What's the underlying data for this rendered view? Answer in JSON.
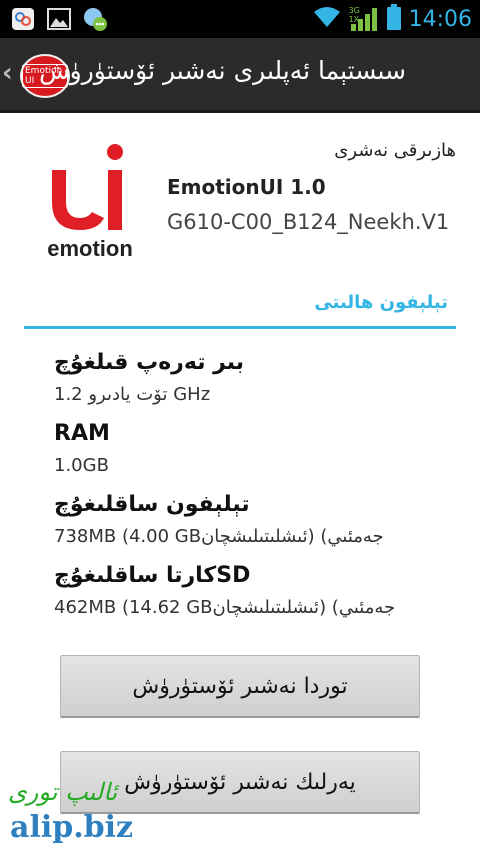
{
  "status_bar": {
    "time": "14:06",
    "network_label_3g": "3G",
    "network_label_1x": "1X",
    "icons": [
      "share-app-icon",
      "gallery-icon",
      "chat-app-icon",
      "wifi-icon",
      "signal-icon",
      "battery-icon"
    ]
  },
  "action_bar": {
    "logo_text": "Emotion UI",
    "title": "سىستېما ئەپلىرى نەشىر ئۆستۈرۈش"
  },
  "brand": {
    "logo_word": "emotion",
    "brand_color": "#e01e26"
  },
  "version": {
    "label": "ھازىرقى نەشرى",
    "product_name": "EmotionUI 1.0",
    "build_number": "G610-C00_B124_Neekh.V1"
  },
  "section": {
    "title": "تېلېفون ھالىتى",
    "accent_color": "#33b5e5"
  },
  "items": [
    {
      "title": "بىر تەرەپ قىلغۇچ",
      "value": "تۆت يادىرو 1.2 GHz"
    },
    {
      "title": "RAM",
      "value": "1.0GB"
    },
    {
      "title": "تېلېفون ساقلىغۇچ",
      "value": "738MB (4.00  GBئىشلىتىلىشچان) (جەمئىي"
    },
    {
      "title": "كارتا ساقلىغۇچSD",
      "value": "462MB (14.62  GBئىشلىتىلىشچان) (جەمئىي"
    }
  ],
  "buttons": {
    "online_update": "توردا نەشىر ئۆستۈرۈش",
    "local_update": "يەرلىك نەشىر ئۆستۈرۈش"
  },
  "watermark": {
    "script_text": "ئالىپ تورى",
    "url": "alip.biz"
  }
}
